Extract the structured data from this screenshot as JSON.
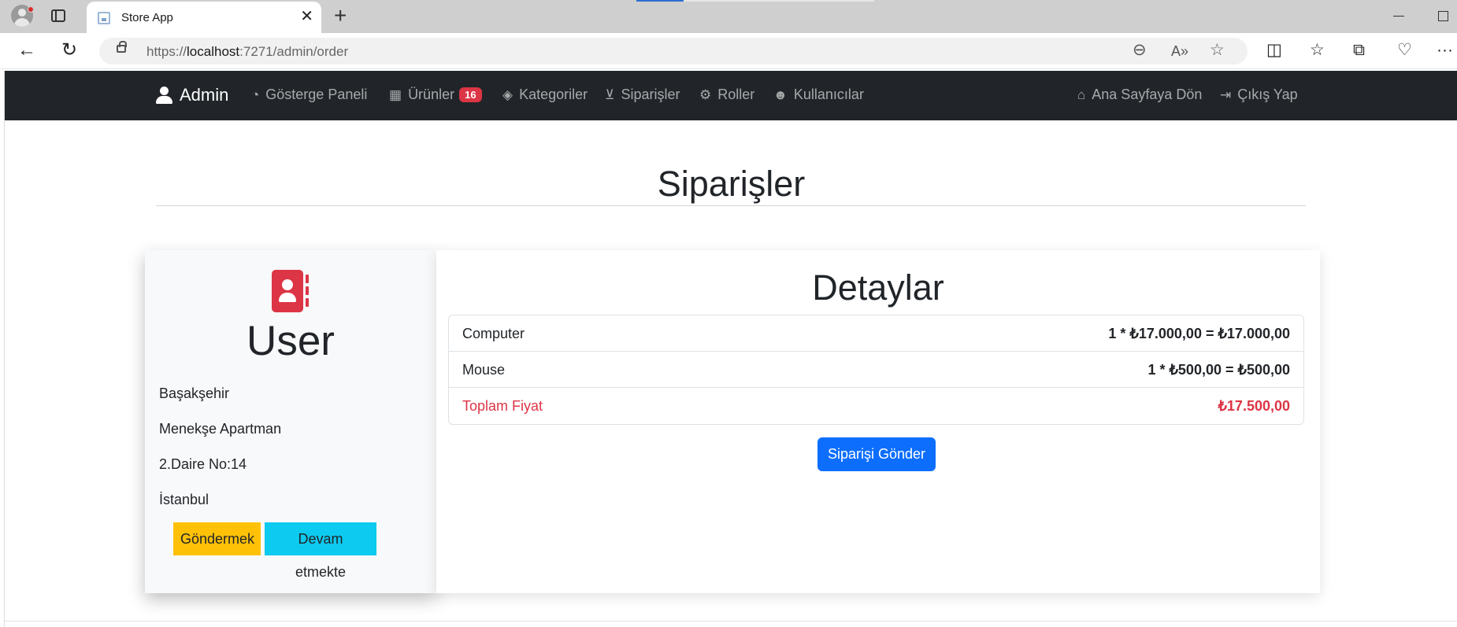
{
  "browser": {
    "tab_title": "Store App",
    "url_scheme": "https://",
    "url_host": "localhost",
    "url_path": ":7271/admin/order"
  },
  "navbar": {
    "brand": "Admin",
    "links": [
      {
        "label": "Gösterge Paneli",
        "icon": "dashboard-icon"
      },
      {
        "label": "Ürünler",
        "icon": "boxes-icon",
        "badge": "16"
      },
      {
        "label": "Kategoriler",
        "icon": "tags-icon"
      },
      {
        "label": "Siparişler",
        "icon": "basket-icon"
      },
      {
        "label": "Roller",
        "icon": "users-gear-icon"
      },
      {
        "label": "Kullanıcılar",
        "icon": "users-icon"
      }
    ],
    "right_links": [
      {
        "label": "Ana Sayfaya Dön",
        "icon": "home-icon"
      },
      {
        "label": "Çıkış Yap",
        "icon": "sign-out-icon"
      }
    ]
  },
  "page": {
    "title": "Siparişler"
  },
  "user_card": {
    "name": "User",
    "address_lines": [
      "Başakşehir",
      "Menekşe Apartman",
      "2.Daire No:14",
      "İstanbul"
    ],
    "buttons": {
      "ship": "Göndermek",
      "in_progress": "Devam etmekte"
    }
  },
  "details": {
    "title": "Detaylar",
    "items": [
      {
        "name": "Computer",
        "price": "1 * ₺17.000,00 = ₺17.000,00"
      },
      {
        "name": "Mouse",
        "price": "1 * ₺500,00 = ₺500,00"
      }
    ],
    "total": {
      "name": "Toplam Fiyat",
      "price": "₺17.500,00"
    },
    "submit_label": "Siparişi Gönder"
  },
  "colors": {
    "navbar_bg": "#212529",
    "danger": "#dc3545",
    "primary": "#0d6efd",
    "warning": "#ffc107",
    "info": "#0dcaf0"
  }
}
